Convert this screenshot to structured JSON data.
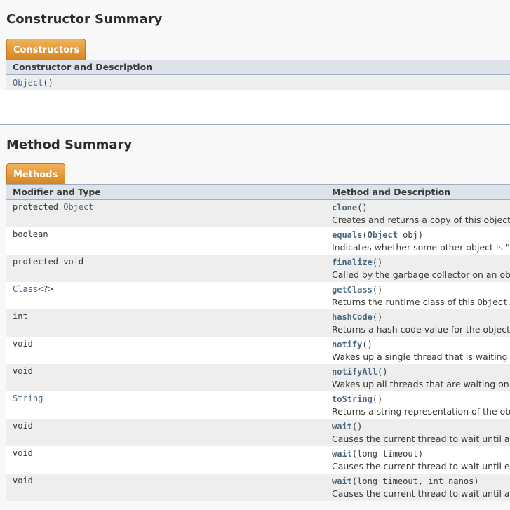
{
  "constructor_summary": {
    "title": "Constructor Summary",
    "tab_label": "Constructors",
    "header": "Constructor and Description",
    "rows": [
      {
        "name": "Object",
        "params": "()"
      }
    ]
  },
  "method_summary": {
    "title": "Method Summary",
    "tab_label": "Methods",
    "header_modifier": "Modifier and Type",
    "header_method": "Method and Description",
    "rows": [
      {
        "modifier_prefix": "protected ",
        "modifier_type": "Object",
        "method": "clone",
        "params": "()",
        "description": "Creates and returns a copy of this object."
      },
      {
        "modifier_prefix": "boolean",
        "modifier_type": "",
        "method": "equals",
        "params_open": "(",
        "params_type": "Object",
        "params_rest": " obj)",
        "description": "Indicates whether some other object is \"equ"
      },
      {
        "modifier_prefix": "protected void",
        "modifier_type": "",
        "method": "finalize",
        "params": "()",
        "description": "Called by the garbage collector on an objec"
      },
      {
        "modifier_prefix": "",
        "modifier_type": "Class",
        "modifier_suffix": "<?>",
        "method": "getClass",
        "params": "()",
        "description": "Returns the runtime class of this ",
        "description_code": "Object",
        "description_end": "."
      },
      {
        "modifier_prefix": "int",
        "modifier_type": "",
        "method": "hashCode",
        "params": "()",
        "description": "Returns a hash code value for the object."
      },
      {
        "modifier_prefix": "void",
        "modifier_type": "",
        "method": "notify",
        "params": "()",
        "description": "Wakes up a single thread that is waiting on"
      },
      {
        "modifier_prefix": "void",
        "modifier_type": "",
        "method": "notifyAll",
        "params": "()",
        "description": "Wakes up all threads that are waiting on thi"
      },
      {
        "modifier_prefix": "",
        "modifier_type": "String",
        "method": "toString",
        "params": "()",
        "description": "Returns a string representation of the objec"
      },
      {
        "modifier_prefix": "void",
        "modifier_type": "",
        "method": "wait",
        "params": "()",
        "description": "Causes the current thread to wait until anot"
      },
      {
        "modifier_prefix": "void",
        "modifier_type": "",
        "method": "wait",
        "params": "(long timeout)",
        "description": "Causes the current thread to wait until eithe"
      },
      {
        "modifier_prefix": "void",
        "modifier_type": "",
        "method": "wait",
        "params": "(long timeout, int nanos)",
        "description": "Causes the current thread to wait until anot"
      }
    ]
  }
}
